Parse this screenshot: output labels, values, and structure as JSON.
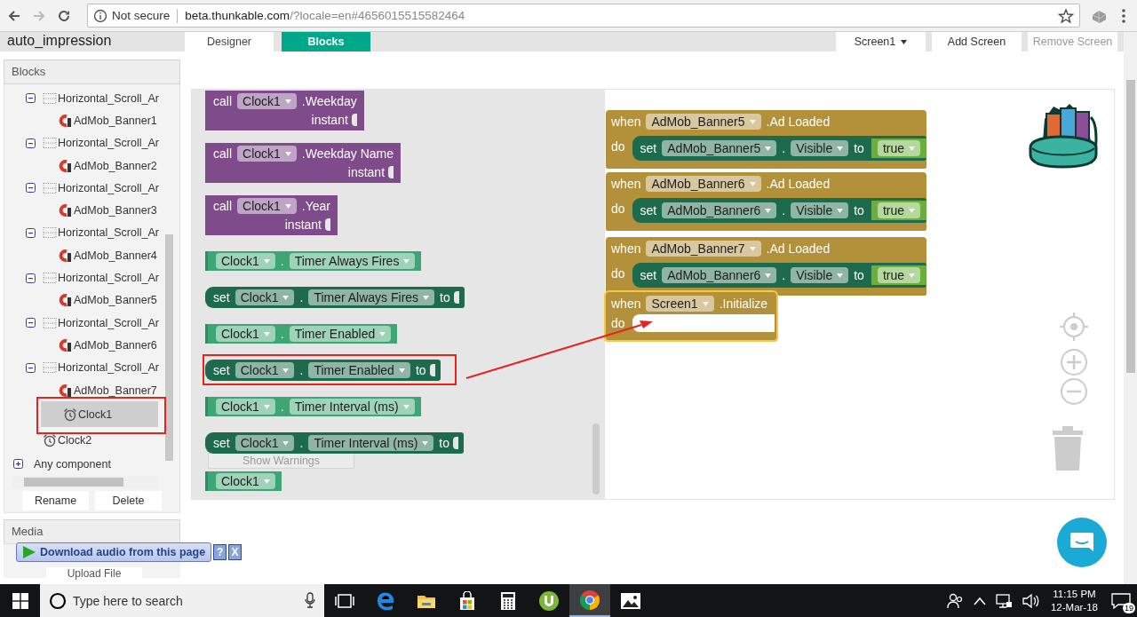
{
  "browser": {
    "security": "Not secure",
    "url": "beta.thunkable.com/?locale=en#4656015515582464"
  },
  "app": {
    "project_title": "auto_impression",
    "tabs": [
      {
        "label": "Designer",
        "selected": false
      },
      {
        "label": "Blocks",
        "selected": true
      }
    ],
    "screen_dropdown": "Screen1",
    "buttons": [
      {
        "label": "Add Screen",
        "disabled": false
      },
      {
        "label": "Remove Screen",
        "disabled": true
      }
    ]
  },
  "blocks_panel": {
    "title": "Blocks",
    "components": [
      {
        "kind": "arrangement",
        "label": "Horizontal_Scroll_Ar",
        "expanded": true,
        "selected": false,
        "children": [
          {
            "kind": "admob",
            "label": "AdMob_Banner1",
            "selected": false
          }
        ]
      },
      {
        "kind": "arrangement",
        "label": "Horizontal_Scroll_Ar",
        "expanded": true,
        "selected": false,
        "children": [
          {
            "kind": "admob",
            "label": "AdMob_Banner2",
            "selected": false
          }
        ]
      },
      {
        "kind": "arrangement",
        "label": "Horizontal_Scroll_Ar",
        "expanded": true,
        "selected": false,
        "children": [
          {
            "kind": "admob",
            "label": "AdMob_Banner3",
            "selected": false
          }
        ]
      },
      {
        "kind": "arrangement",
        "label": "Horizontal_Scroll_Ar",
        "expanded": true,
        "selected": false,
        "children": [
          {
            "kind": "admob",
            "label": "AdMob_Banner4",
            "selected": false
          }
        ]
      },
      {
        "kind": "arrangement",
        "label": "Horizontal_Scroll_Ar",
        "expanded": true,
        "selected": false,
        "children": [
          {
            "kind": "admob",
            "label": "AdMob_Banner5",
            "selected": false
          }
        ]
      },
      {
        "kind": "arrangement",
        "label": "Horizontal_Scroll_Ar",
        "expanded": true,
        "selected": false,
        "children": [
          {
            "kind": "admob",
            "label": "AdMob_Banner6",
            "selected": false
          }
        ]
      },
      {
        "kind": "arrangement",
        "label": "Horizontal_Scroll_Ar",
        "expanded": true,
        "selected": false,
        "children": [
          {
            "kind": "admob",
            "label": "AdMob_Banner7",
            "selected": false
          }
        ]
      },
      {
        "kind": "clock",
        "label": "Clock1",
        "selected": true
      },
      {
        "kind": "clock",
        "label": "Clock2",
        "selected": false
      }
    ],
    "any_component": {
      "label": "Any component",
      "expanded": false
    },
    "buttons": [
      "Rename",
      "Delete"
    ]
  },
  "media_panel": {
    "title": "Media",
    "upload_button": "Upload File"
  },
  "download_bar": {
    "label": "Download audio from this page",
    "help": "?",
    "close": "X"
  },
  "flyout": [
    {
      "kind": "call",
      "lines": [
        [
          {
            "kind": "word",
            "text": "call"
          },
          {
            "kind": "dropdown",
            "text": "Clock1"
          },
          {
            "kind": "word",
            "text": ".Weekday"
          }
        ],
        [
          {
            "kind": "word",
            "text": "instant"
          }
        ]
      ]
    },
    {
      "kind": "call",
      "lines": [
        [
          {
            "kind": "word",
            "text": "call"
          },
          {
            "kind": "dropdown",
            "text": "Clock1"
          },
          {
            "kind": "word",
            "text": ".Weekday Name"
          }
        ],
        [
          {
            "kind": "word",
            "text": "instant"
          }
        ]
      ]
    },
    {
      "kind": "call",
      "lines": [
        [
          {
            "kind": "word",
            "text": "call"
          },
          {
            "kind": "dropdown",
            "text": "Clock1"
          },
          {
            "kind": "word",
            "text": ".Year"
          }
        ],
        [
          {
            "kind": "word",
            "text": "instant"
          }
        ]
      ]
    },
    {
      "kind": "getter",
      "tokens": [
        {
          "kind": "dropdown",
          "text": "Clock1"
        },
        {
          "kind": "word",
          "text": "."
        },
        {
          "kind": "dropdown",
          "text": "Timer Always Fires"
        }
      ]
    },
    {
      "kind": "setter",
      "tokens": [
        {
          "kind": "word",
          "text": "set"
        },
        {
          "kind": "dropdown",
          "text": "Clock1"
        },
        {
          "kind": "word",
          "text": "."
        },
        {
          "kind": "dropdown",
          "text": "Timer Always Fires"
        },
        {
          "kind": "word",
          "text": "to"
        }
      ]
    },
    {
      "kind": "getter",
      "tokens": [
        {
          "kind": "dropdown",
          "text": "Clock1"
        },
        {
          "kind": "word",
          "text": "."
        },
        {
          "kind": "dropdown",
          "text": "Timer Enabled"
        }
      ]
    },
    {
      "kind": "setter",
      "tokens": [
        {
          "kind": "word",
          "text": "set"
        },
        {
          "kind": "dropdown",
          "text": "Clock1"
        },
        {
          "kind": "word",
          "text": "."
        },
        {
          "kind": "dropdown",
          "text": "Timer Enabled"
        },
        {
          "kind": "word",
          "text": "to"
        }
      ]
    },
    {
      "kind": "getter",
      "tokens": [
        {
          "kind": "dropdown",
          "text": "Clock1"
        },
        {
          "kind": "word",
          "text": "."
        },
        {
          "kind": "dropdown",
          "text": "Timer Interval (ms)"
        }
      ]
    },
    {
      "kind": "setter",
      "tokens": [
        {
          "kind": "word",
          "text": "set"
        },
        {
          "kind": "dropdown",
          "text": "Clock1"
        },
        {
          "kind": "word",
          "text": "."
        },
        {
          "kind": "dropdown",
          "text": "Timer Interval (ms)"
        },
        {
          "kind": "word",
          "text": "to"
        }
      ]
    },
    {
      "kind": "button",
      "label": "Show Warnings"
    },
    {
      "kind": "getter",
      "tokens": [
        {
          "kind": "dropdown",
          "text": "Clock1"
        }
      ]
    }
  ],
  "workspace": {
    "events": [
      {
        "selected": false,
        "head": [
          {
            "kind": "word",
            "text": "when"
          },
          {
            "kind": "dropdown",
            "text": "AdMob_Banner5"
          },
          {
            "kind": "word",
            "text": ".Ad Loaded"
          }
        ],
        "do_label": "do",
        "statement": {
          "kind": "setter",
          "tokens": [
            {
              "kind": "word",
              "text": "set"
            },
            {
              "kind": "dropdown",
              "text": "AdMob_Banner5"
            },
            {
              "kind": "word",
              "text": "."
            },
            {
              "kind": "dropdown",
              "text": "Visible"
            },
            {
              "kind": "word",
              "text": "to"
            }
          ],
          "value": {
            "kind": "boolean",
            "tokens": [
              {
                "kind": "dropdown",
                "text": "true"
              }
            ]
          }
        }
      },
      {
        "selected": false,
        "head": [
          {
            "kind": "word",
            "text": "when"
          },
          {
            "kind": "dropdown",
            "text": "AdMob_Banner6"
          },
          {
            "kind": "word",
            "text": ".Ad Loaded"
          }
        ],
        "do_label": "do",
        "statement": {
          "kind": "setter",
          "tokens": [
            {
              "kind": "word",
              "text": "set"
            },
            {
              "kind": "dropdown",
              "text": "AdMob_Banner6"
            },
            {
              "kind": "word",
              "text": "."
            },
            {
              "kind": "dropdown",
              "text": "Visible"
            },
            {
              "kind": "word",
              "text": "to"
            }
          ],
          "value": {
            "kind": "boolean",
            "tokens": [
              {
                "kind": "dropdown",
                "text": "true"
              }
            ]
          }
        }
      },
      {
        "selected": false,
        "head": [
          {
            "kind": "word",
            "text": "when"
          },
          {
            "kind": "dropdown",
            "text": "AdMob_Banner7"
          },
          {
            "kind": "word",
            "text": ".Ad Loaded"
          }
        ],
        "do_label": "do",
        "statement": {
          "kind": "setter",
          "tokens": [
            {
              "kind": "word",
              "text": "set"
            },
            {
              "kind": "dropdown",
              "text": "AdMob_Banner6"
            },
            {
              "kind": "word",
              "text": "."
            },
            {
              "kind": "dropdown",
              "text": "Visible"
            },
            {
              "kind": "word",
              "text": "to"
            }
          ],
          "value": {
            "kind": "boolean",
            "tokens": [
              {
                "kind": "dropdown",
                "text": "true"
              }
            ]
          }
        }
      },
      {
        "selected": true,
        "head": [
          {
            "kind": "word",
            "text": "when"
          },
          {
            "kind": "dropdown",
            "text": "Screen1"
          },
          {
            "kind": "word",
            "text": ".Initialize"
          }
        ],
        "do_label": "do"
      }
    ]
  },
  "taskbar": {
    "search_placeholder": "Type here to search",
    "apps": [
      {
        "kind": "taskview",
        "active": false
      },
      {
        "kind": "edge",
        "active": false
      },
      {
        "kind": "explorer",
        "active": false
      },
      {
        "kind": "store",
        "active": false
      },
      {
        "kind": "calculator",
        "active": false
      },
      {
        "kind": "torrent",
        "active": false
      },
      {
        "kind": "chrome",
        "active": true
      },
      {
        "kind": "photos",
        "active": false
      }
    ],
    "time": "11:15 PM",
    "date": "12-Mar-18",
    "notifications": "19"
  }
}
